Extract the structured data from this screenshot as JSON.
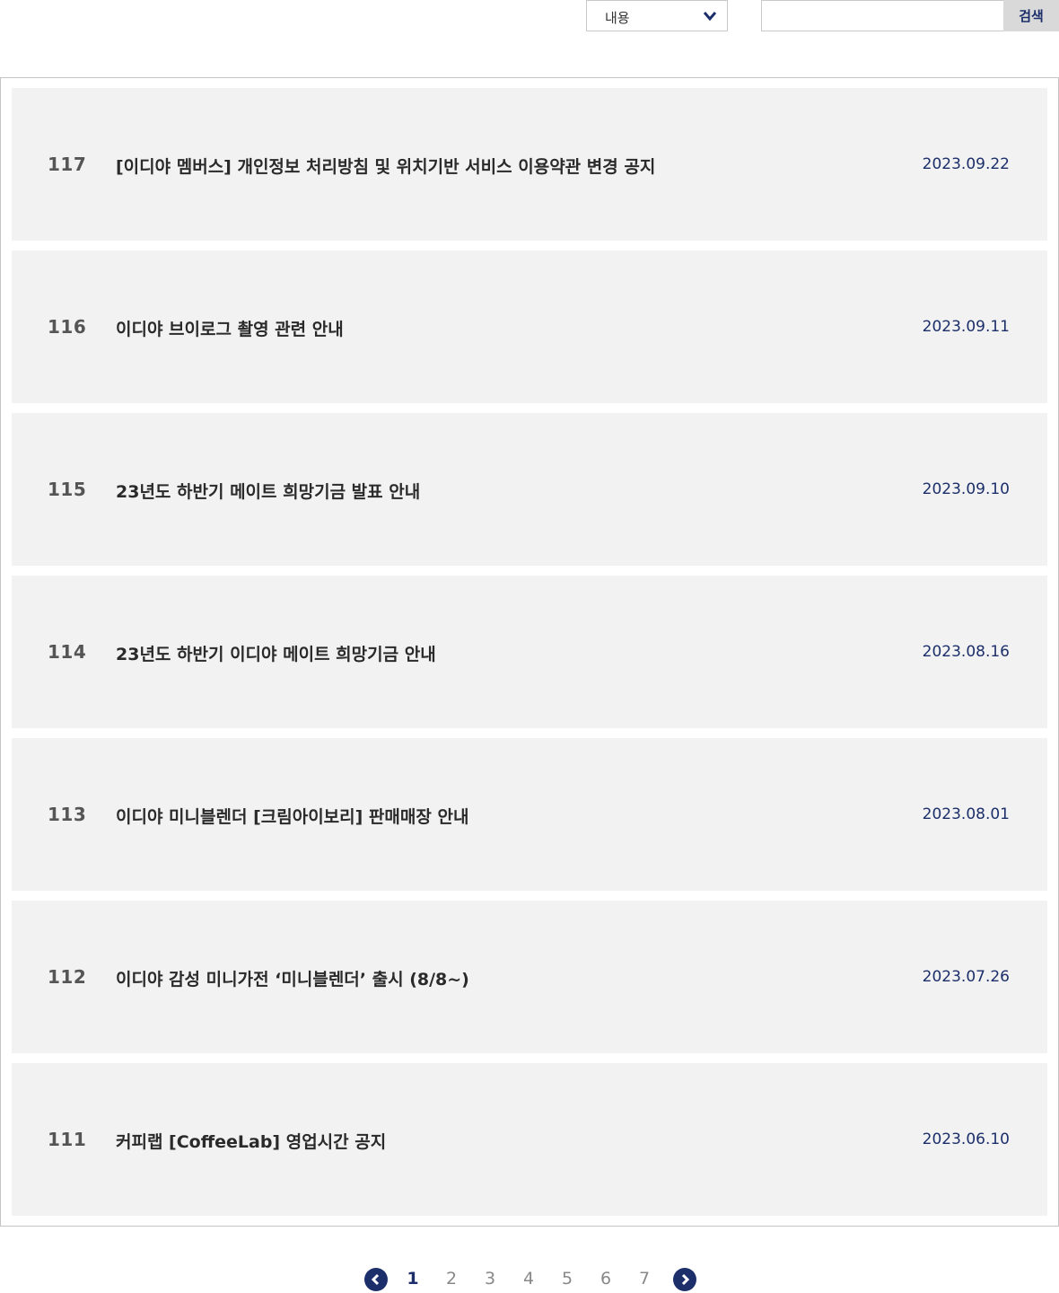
{
  "search": {
    "select_value": "내용",
    "input_value": "",
    "button_label": "검색"
  },
  "notices": [
    {
      "num": "117",
      "title": "[이디야 멤버스] 개인정보 처리방침 및 위치기반 서비스 이용약관 변경 공지",
      "date": "2023.09.22"
    },
    {
      "num": "116",
      "title": "이디야 브이로그 촬영 관련 안내",
      "date": "2023.09.11"
    },
    {
      "num": "115",
      "title": "23년도 하반기 메이트 희망기금 발표 안내",
      "date": "2023.09.10"
    },
    {
      "num": "114",
      "title": "23년도 하반기 이디야 메이트 희망기금 안내",
      "date": "2023.08.16"
    },
    {
      "num": "113",
      "title": "이디야 미니블렌더 [크림아이보리] 판매매장 안내",
      "date": "2023.08.01"
    },
    {
      "num": "112",
      "title": "이디야 감성 미니가전 ‘미니블렌더’ 출시 (8/8~)",
      "date": "2023.07.26"
    },
    {
      "num": "111",
      "title": "커피랩 [CoffeeLab] 영업시간 공지",
      "date": "2023.06.10"
    }
  ],
  "pagination": {
    "pages": [
      "1",
      "2",
      "3",
      "4",
      "5",
      "6",
      "7"
    ],
    "current": "1",
    "prev_icon": "chevron-left-circle-icon",
    "next_icon": "chevron-right-circle-icon"
  },
  "colors": {
    "accent": "#1c2f6b",
    "row_bg": "#f2f2f2",
    "button_bg": "#d9d9d9"
  }
}
